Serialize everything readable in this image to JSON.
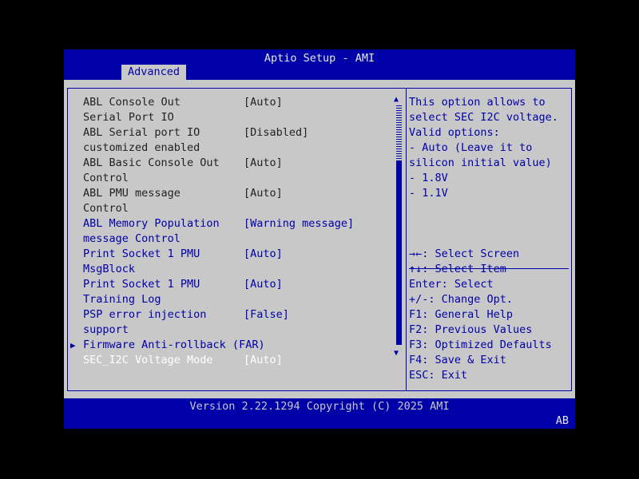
{
  "header": {
    "title": "Aptio Setup - AMI",
    "tab": "Advanced"
  },
  "items": [
    {
      "label": "ABL Console Out\nSerial Port IO",
      "value": "[Auto]",
      "style": "dark"
    },
    {
      "label": "ABL Serial port IO\ncustomized enabled",
      "value": "[Disabled]",
      "style": "dark"
    },
    {
      "label": "ABL Basic Console Out\nControl",
      "value": "[Auto]",
      "style": "dark"
    },
    {
      "label": "ABL PMU message\nControl",
      "value": "[Auto]",
      "style": "dark"
    },
    {
      "label": "ABL Memory Population\nmessage Control",
      "value": "[Warning message]",
      "style": "blue"
    },
    {
      "label": "Print Socket 1 PMU\nMsgBlock",
      "value": "[Auto]",
      "style": "blue"
    },
    {
      "label": "Print Socket 1 PMU\nTraining Log",
      "value": "[Auto]",
      "style": "blue"
    },
    {
      "label": "PSP error injection\nsupport",
      "value": "[False]",
      "style": "blue"
    },
    {
      "label": "Firmware Anti-rollback (FAR)",
      "value": "",
      "style": "blue",
      "submenu": true
    },
    {
      "label": "SEC_I2C Voltage Mode",
      "value": "[Auto]",
      "style": "white"
    }
  ],
  "help": {
    "lines": [
      "This option allows to",
      "select SEC I2C voltage.",
      "Valid options:",
      "- Auto (Leave it to",
      "silicon initial value)",
      "- 1.8V",
      "- 1.1V"
    ]
  },
  "keys": [
    "→←: Select Screen",
    "↑↓: Select Item",
    "Enter: Select",
    "+/-: Change Opt.",
    "F1: General Help",
    "F2: Previous Values",
    "F3: Optimized Defaults",
    "F4: Save & Exit",
    "ESC: Exit"
  ],
  "footer": {
    "version": "Version 2.22.1294 Copyright (C) 2025 AMI",
    "badge": "AB"
  },
  "colors": {
    "background": "#0000a8",
    "panel": "#c8c8c8",
    "highlight": "#ffffff"
  }
}
